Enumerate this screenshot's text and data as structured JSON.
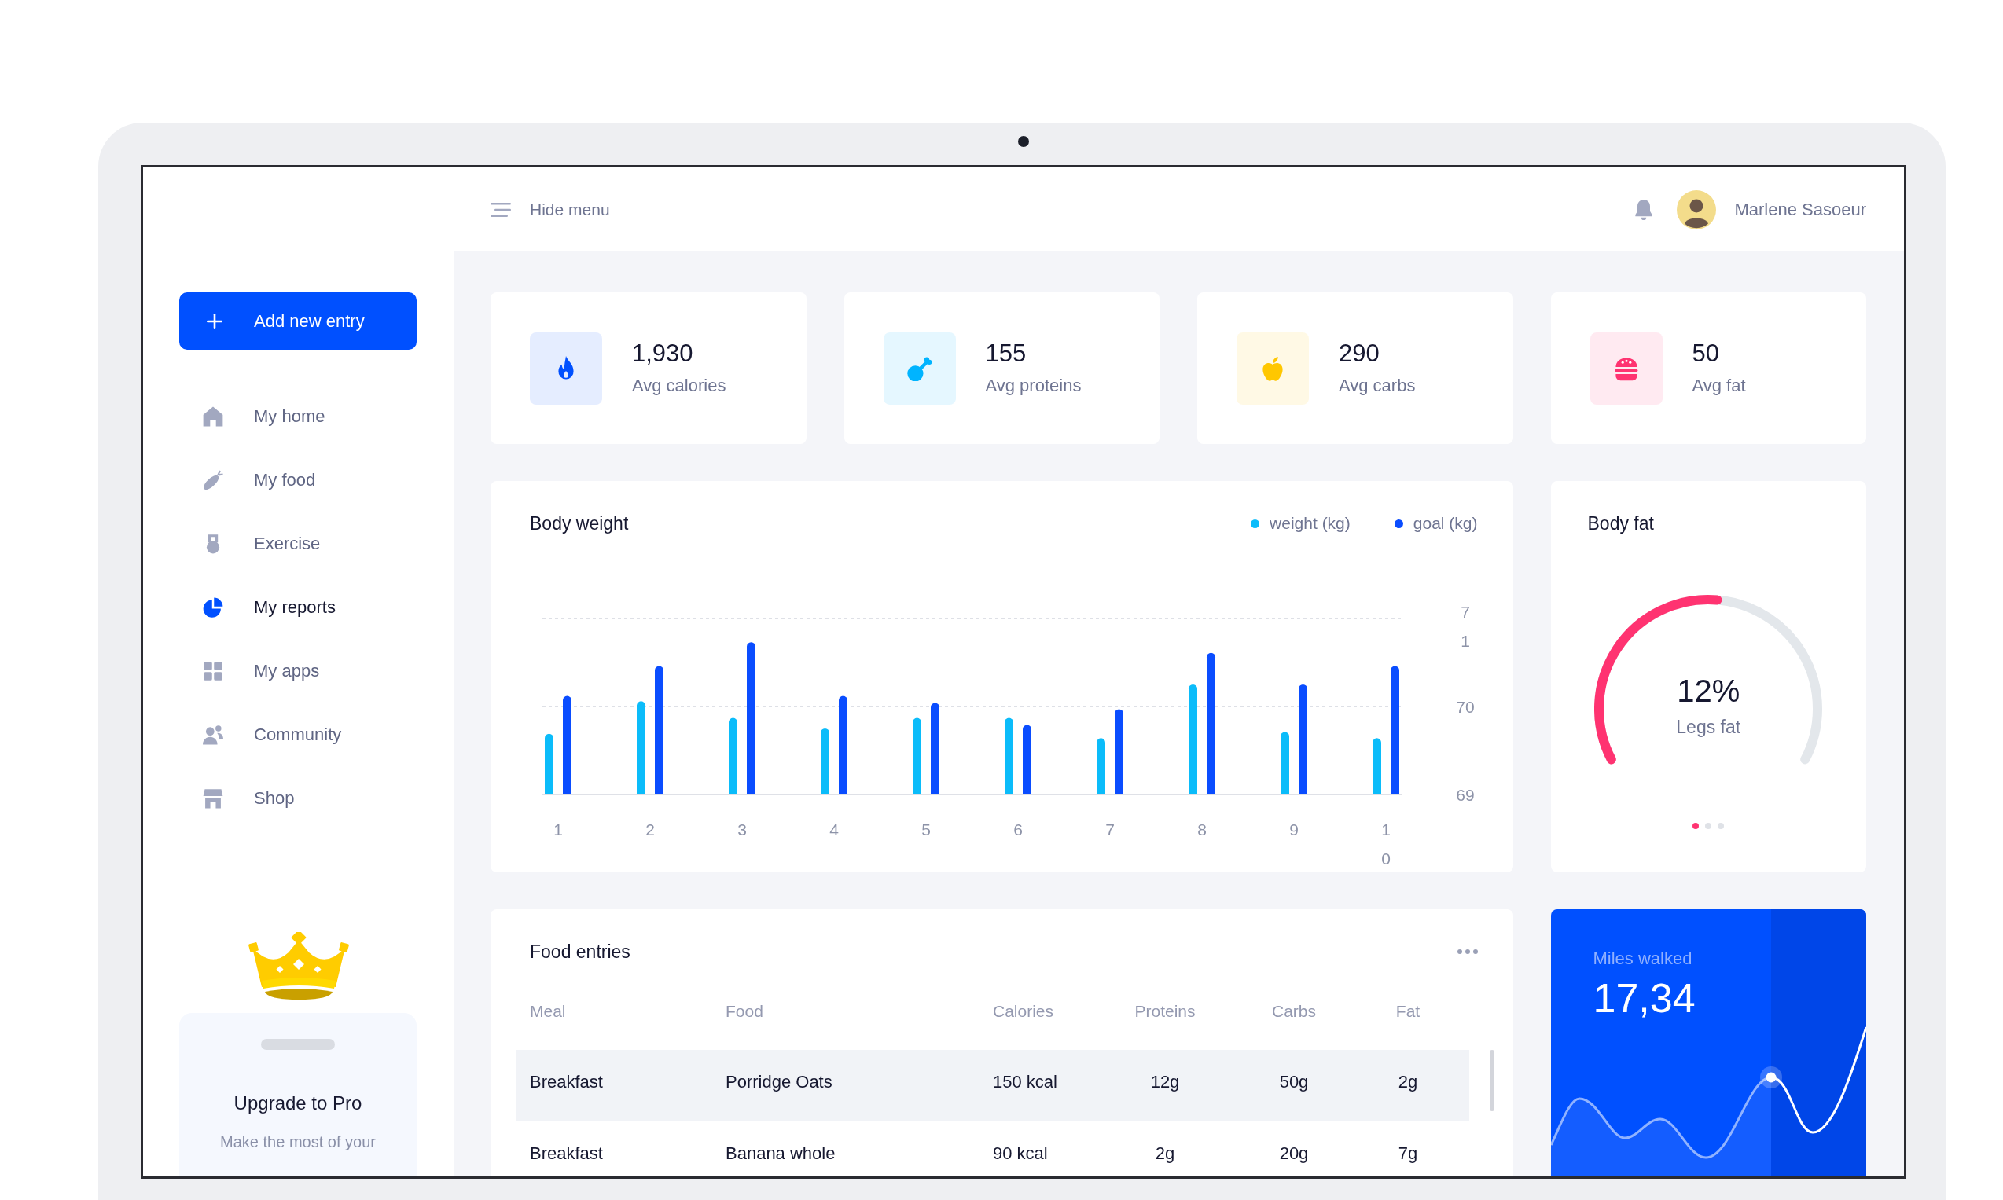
{
  "topbar": {
    "menu_label": "Hide menu",
    "user_name": "Marlene Sasoeur"
  },
  "sidebar": {
    "add_button": "Add new entry",
    "items": [
      {
        "label": "My home",
        "selected": false
      },
      {
        "label": "My food",
        "selected": false
      },
      {
        "label": "Exercise",
        "selected": false
      },
      {
        "label": "My reports",
        "selected": true
      },
      {
        "label": "My apps",
        "selected": false
      },
      {
        "label": "Community",
        "selected": false
      },
      {
        "label": "Shop",
        "selected": false
      }
    ],
    "upgrade": {
      "title": "Upgrade to Pro",
      "text": "Make the most of your"
    }
  },
  "stats": [
    {
      "value": "1,930",
      "label": "Avg calories",
      "color": "#0050ff"
    },
    {
      "value": "155",
      "label": "Avg proteins",
      "color": "#00b4ff"
    },
    {
      "value": "290",
      "label": "Avg carbs",
      "color": "#ffc700"
    },
    {
      "value": "50",
      "label": "Avg fat",
      "color": "#ff3371"
    }
  ],
  "body_weight": {
    "chart_data": {
      "type": "bar",
      "title": "Body weight",
      "categories": [
        "1",
        "2",
        "3",
        "4",
        "5",
        "6",
        "7",
        "8",
        "9",
        "10"
      ],
      "series": [
        {
          "name": "weight (kg)",
          "color": "#0bbcfa",
          "values": [
            69.69,
            70.06,
            69.87,
            69.75,
            69.87,
            69.87,
            69.64,
            70.25,
            69.71,
            69.64
          ]
        },
        {
          "name": "goal (kg)",
          "color": "#0a4dff",
          "values": [
            70.12,
            70.46,
            70.73,
            70.12,
            70.04,
            69.79,
            69.97,
            70.61,
            70.25,
            70.46
          ]
        }
      ],
      "ylim": [
        69,
        71
      ],
      "yticks": [
        69,
        70,
        71
      ]
    }
  },
  "body_fat": {
    "title": "Body fat",
    "value": "12%",
    "label": "Legs fat",
    "level": 0.52,
    "pages": [
      {
        "selected": true
      },
      {
        "selected": false
      },
      {
        "selected": false
      }
    ]
  },
  "food_entries": {
    "title": "Food entries",
    "columns": [
      "Meal",
      "Food",
      "Calories",
      "Proteins",
      "Carbs",
      "Fat"
    ],
    "rows": [
      {
        "selected": true,
        "cells": [
          "Breakfast",
          "Porridge Oats",
          "150 kcal",
          "12g",
          "50g",
          "2g"
        ]
      },
      {
        "selected": false,
        "cells": [
          "Breakfast",
          "Banana whole",
          "90 kcal",
          "2g",
          "20g",
          "7g"
        ]
      }
    ]
  },
  "miles": {
    "label": "Miles walked",
    "value": "17,34"
  }
}
